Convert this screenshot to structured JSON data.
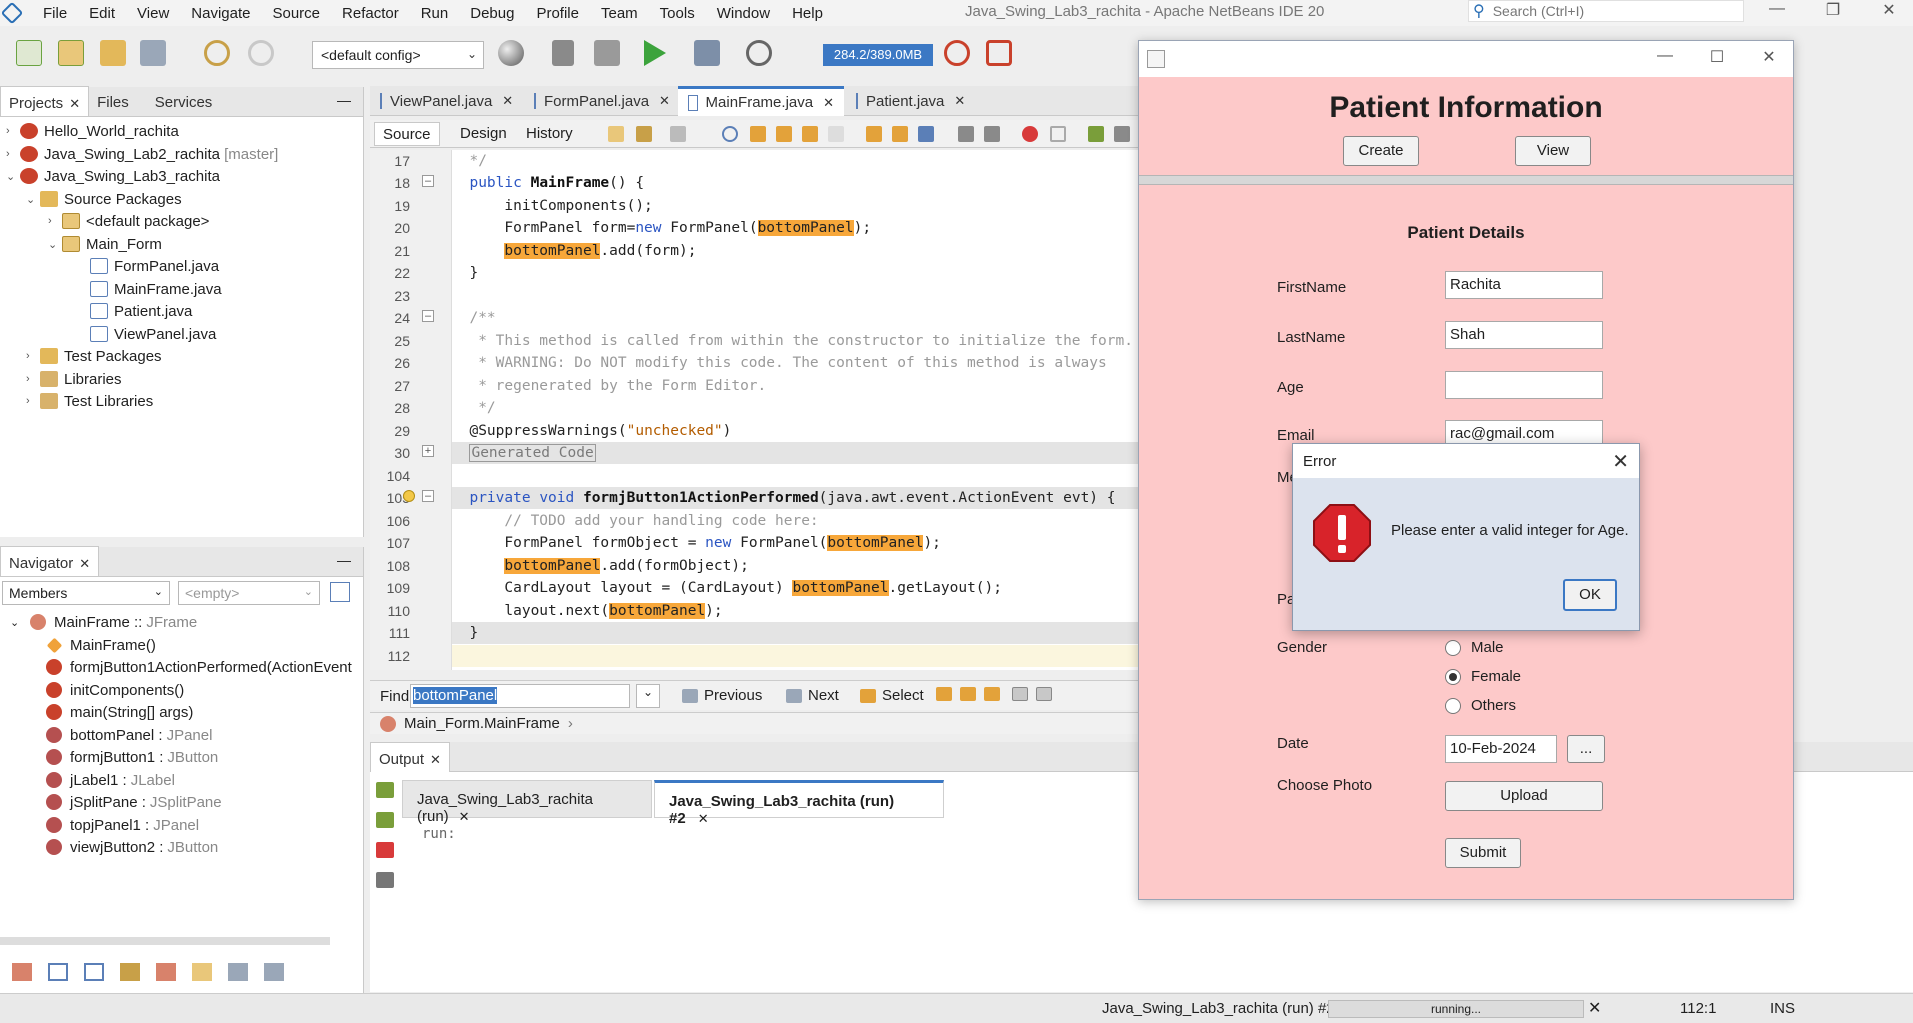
{
  "menubar": {
    "items": [
      "File",
      "Edit",
      "View",
      "Navigate",
      "Source",
      "Refactor",
      "Run",
      "Debug",
      "Profile",
      "Team",
      "Tools",
      "Window",
      "Help"
    ],
    "window_title": "Java_Swing_Lab3_rachita - Apache NetBeans IDE 20",
    "search_placeholder": "Search (Ctrl+I)"
  },
  "toolbar": {
    "config": "<default config>",
    "memory": "284.2/389.0MB"
  },
  "projects_panel": {
    "tabs": [
      "Projects",
      "Files",
      "Services"
    ],
    "tree": [
      {
        "label": "Hello_World_rachita",
        "suffix": ""
      },
      {
        "label": "Java_Swing_Lab2_rachita",
        "suffix": "[master]"
      },
      {
        "label": "Java_Swing_Lab3_rachita",
        "suffix": ""
      },
      {
        "label": "Source Packages",
        "suffix": ""
      },
      {
        "label": "<default package>",
        "suffix": ""
      },
      {
        "label": "Main_Form",
        "suffix": ""
      },
      {
        "label": "FormPanel.java",
        "suffix": ""
      },
      {
        "label": "MainFrame.java",
        "suffix": ""
      },
      {
        "label": "Patient.java",
        "suffix": ""
      },
      {
        "label": "ViewPanel.java",
        "suffix": ""
      },
      {
        "label": "Test Packages",
        "suffix": ""
      },
      {
        "label": "Libraries",
        "suffix": ""
      },
      {
        "label": "Test Libraries",
        "suffix": ""
      }
    ]
  },
  "navigator": {
    "title": "Navigator",
    "filter": "Members",
    "filter2": "<empty>",
    "items": [
      {
        "name": "MainFrame :: ",
        "type": "JFrame"
      },
      {
        "name": "MainFrame()",
        "type": ""
      },
      {
        "name": "formjButton1ActionPerformed(ActionEvent",
        "type": ""
      },
      {
        "name": "initComponents()",
        "type": ""
      },
      {
        "name": "main(String[] args)",
        "type": ""
      },
      {
        "name": "bottomPanel : ",
        "type": "JPanel"
      },
      {
        "name": "formjButton1 : ",
        "type": "JButton"
      },
      {
        "name": "jLabel1 : ",
        "type": "JLabel"
      },
      {
        "name": "jSplitPane : ",
        "type": "JSplitPane"
      },
      {
        "name": "topjPanel1 : ",
        "type": "JPanel"
      },
      {
        "name": "viewjButton2 : ",
        "type": "JButton"
      }
    ]
  },
  "editor": {
    "tabs": [
      "ViewPanel.java",
      "FormPanel.java",
      "MainFrame.java",
      "Patient.java"
    ],
    "active_tab": "MainFrame.java",
    "views": [
      "Source",
      "Design",
      "History"
    ],
    "line_numbers": [
      "17",
      "18",
      "19",
      "20",
      "21",
      "22",
      "23",
      "24",
      "25",
      "26",
      "27",
      "28",
      "29",
      "30",
      "104",
      "105",
      "106",
      "107",
      "108",
      "109",
      "110",
      "111",
      "112"
    ],
    "find_label": "Find:",
    "find_value": "bottomPanel",
    "find_buttons": [
      "Previous",
      "Next",
      "Select"
    ],
    "breadcrumb": "Main_Form.MainFrame"
  },
  "output": {
    "title": "Output",
    "tabs": [
      "Java_Swing_Lab3_rachita (run)",
      "Java_Swing_Lab3_rachita (run) #2"
    ],
    "text": "run:"
  },
  "statusbar": {
    "task": "Java_Swing_Lab3_rachita (run) #2",
    "progress": "running...",
    "position": "112:1",
    "mode": "INS"
  },
  "patient_app": {
    "title": "Patient Information",
    "create_label": "Create",
    "view_label": "View",
    "form_title": "Patient Details",
    "firstname_label": "FirstName",
    "firstname_value": "Rachita",
    "lastname_label": "LastName",
    "lastname_value": "Shah",
    "age_label": "Age",
    "age_value": "",
    "email_label": "Email",
    "email_value": "rac@gmail.com",
    "hidden_label_1": "Me",
    "hidden_label_2": "Pa",
    "gender_label": "Gender",
    "gender_options": [
      "Male",
      "Female",
      "Others"
    ],
    "gender_selected": "Female",
    "date_label": "Date",
    "date_value": "10-Feb-2024",
    "date_button": "...",
    "photo_label": "Choose Photo",
    "upload_label": "Upload",
    "submit_label": "Submit"
  },
  "error_dialog": {
    "title": "Error",
    "message": "Please enter a valid integer for Age.",
    "ok_label": "OK"
  }
}
